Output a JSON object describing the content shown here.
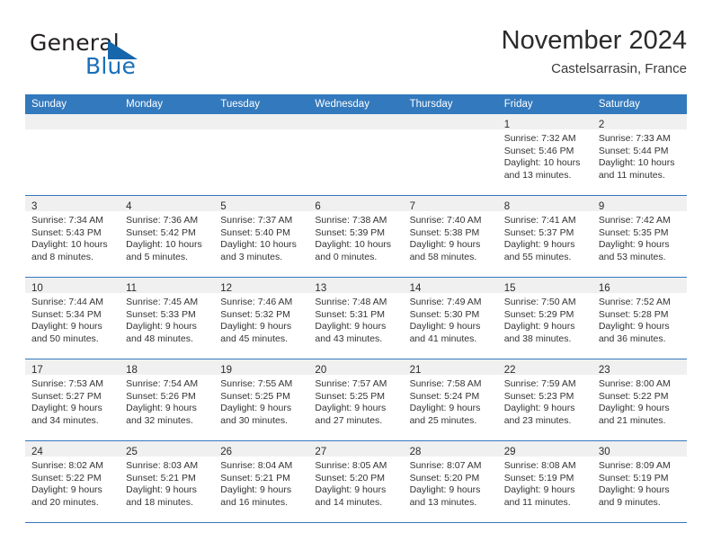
{
  "brand": {
    "word1": "General",
    "word2": "Blue",
    "flag_icon": "triangle-flag-icon",
    "blue": "#1566ab"
  },
  "header": {
    "title": "November 2024",
    "subtitle": "Castelsarrasin, France"
  },
  "calendar": {
    "accent_color": "#3379bd",
    "daynum_band_color": "#f0f0f0",
    "day_headers": [
      "Sunday",
      "Monday",
      "Tuesday",
      "Wednesday",
      "Thursday",
      "Friday",
      "Saturday"
    ],
    "weeks": [
      [
        {
          "day": "",
          "sunrise": "",
          "sunset": "",
          "daylight": ""
        },
        {
          "day": "",
          "sunrise": "",
          "sunset": "",
          "daylight": ""
        },
        {
          "day": "",
          "sunrise": "",
          "sunset": "",
          "daylight": ""
        },
        {
          "day": "",
          "sunrise": "",
          "sunset": "",
          "daylight": ""
        },
        {
          "day": "",
          "sunrise": "",
          "sunset": "",
          "daylight": ""
        },
        {
          "day": "1",
          "sunrise": "Sunrise: 7:32 AM",
          "sunset": "Sunset: 5:46 PM",
          "daylight": "Daylight: 10 hours and 13 minutes."
        },
        {
          "day": "2",
          "sunrise": "Sunrise: 7:33 AM",
          "sunset": "Sunset: 5:44 PM",
          "daylight": "Daylight: 10 hours and 11 minutes."
        }
      ],
      [
        {
          "day": "3",
          "sunrise": "Sunrise: 7:34 AM",
          "sunset": "Sunset: 5:43 PM",
          "daylight": "Daylight: 10 hours and 8 minutes."
        },
        {
          "day": "4",
          "sunrise": "Sunrise: 7:36 AM",
          "sunset": "Sunset: 5:42 PM",
          "daylight": "Daylight: 10 hours and 5 minutes."
        },
        {
          "day": "5",
          "sunrise": "Sunrise: 7:37 AM",
          "sunset": "Sunset: 5:40 PM",
          "daylight": "Daylight: 10 hours and 3 minutes."
        },
        {
          "day": "6",
          "sunrise": "Sunrise: 7:38 AM",
          "sunset": "Sunset: 5:39 PM",
          "daylight": "Daylight: 10 hours and 0 minutes."
        },
        {
          "day": "7",
          "sunrise": "Sunrise: 7:40 AM",
          "sunset": "Sunset: 5:38 PM",
          "daylight": "Daylight: 9 hours and 58 minutes."
        },
        {
          "day": "8",
          "sunrise": "Sunrise: 7:41 AM",
          "sunset": "Sunset: 5:37 PM",
          "daylight": "Daylight: 9 hours and 55 minutes."
        },
        {
          "day": "9",
          "sunrise": "Sunrise: 7:42 AM",
          "sunset": "Sunset: 5:35 PM",
          "daylight": "Daylight: 9 hours and 53 minutes."
        }
      ],
      [
        {
          "day": "10",
          "sunrise": "Sunrise: 7:44 AM",
          "sunset": "Sunset: 5:34 PM",
          "daylight": "Daylight: 9 hours and 50 minutes."
        },
        {
          "day": "11",
          "sunrise": "Sunrise: 7:45 AM",
          "sunset": "Sunset: 5:33 PM",
          "daylight": "Daylight: 9 hours and 48 minutes."
        },
        {
          "day": "12",
          "sunrise": "Sunrise: 7:46 AM",
          "sunset": "Sunset: 5:32 PM",
          "daylight": "Daylight: 9 hours and 45 minutes."
        },
        {
          "day": "13",
          "sunrise": "Sunrise: 7:48 AM",
          "sunset": "Sunset: 5:31 PM",
          "daylight": "Daylight: 9 hours and 43 minutes."
        },
        {
          "day": "14",
          "sunrise": "Sunrise: 7:49 AM",
          "sunset": "Sunset: 5:30 PM",
          "daylight": "Daylight: 9 hours and 41 minutes."
        },
        {
          "day": "15",
          "sunrise": "Sunrise: 7:50 AM",
          "sunset": "Sunset: 5:29 PM",
          "daylight": "Daylight: 9 hours and 38 minutes."
        },
        {
          "day": "16",
          "sunrise": "Sunrise: 7:52 AM",
          "sunset": "Sunset: 5:28 PM",
          "daylight": "Daylight: 9 hours and 36 minutes."
        }
      ],
      [
        {
          "day": "17",
          "sunrise": "Sunrise: 7:53 AM",
          "sunset": "Sunset: 5:27 PM",
          "daylight": "Daylight: 9 hours and 34 minutes."
        },
        {
          "day": "18",
          "sunrise": "Sunrise: 7:54 AM",
          "sunset": "Sunset: 5:26 PM",
          "daylight": "Daylight: 9 hours and 32 minutes."
        },
        {
          "day": "19",
          "sunrise": "Sunrise: 7:55 AM",
          "sunset": "Sunset: 5:25 PM",
          "daylight": "Daylight: 9 hours and 30 minutes."
        },
        {
          "day": "20",
          "sunrise": "Sunrise: 7:57 AM",
          "sunset": "Sunset: 5:25 PM",
          "daylight": "Daylight: 9 hours and 27 minutes."
        },
        {
          "day": "21",
          "sunrise": "Sunrise: 7:58 AM",
          "sunset": "Sunset: 5:24 PM",
          "daylight": "Daylight: 9 hours and 25 minutes."
        },
        {
          "day": "22",
          "sunrise": "Sunrise: 7:59 AM",
          "sunset": "Sunset: 5:23 PM",
          "daylight": "Daylight: 9 hours and 23 minutes."
        },
        {
          "day": "23",
          "sunrise": "Sunrise: 8:00 AM",
          "sunset": "Sunset: 5:22 PM",
          "daylight": "Daylight: 9 hours and 21 minutes."
        }
      ],
      [
        {
          "day": "24",
          "sunrise": "Sunrise: 8:02 AM",
          "sunset": "Sunset: 5:22 PM",
          "daylight": "Daylight: 9 hours and 20 minutes."
        },
        {
          "day": "25",
          "sunrise": "Sunrise: 8:03 AM",
          "sunset": "Sunset: 5:21 PM",
          "daylight": "Daylight: 9 hours and 18 minutes."
        },
        {
          "day": "26",
          "sunrise": "Sunrise: 8:04 AM",
          "sunset": "Sunset: 5:21 PM",
          "daylight": "Daylight: 9 hours and 16 minutes."
        },
        {
          "day": "27",
          "sunrise": "Sunrise: 8:05 AM",
          "sunset": "Sunset: 5:20 PM",
          "daylight": "Daylight: 9 hours and 14 minutes."
        },
        {
          "day": "28",
          "sunrise": "Sunrise: 8:07 AM",
          "sunset": "Sunset: 5:20 PM",
          "daylight": "Daylight: 9 hours and 13 minutes."
        },
        {
          "day": "29",
          "sunrise": "Sunrise: 8:08 AM",
          "sunset": "Sunset: 5:19 PM",
          "daylight": "Daylight: 9 hours and 11 minutes."
        },
        {
          "day": "30",
          "sunrise": "Sunrise: 8:09 AM",
          "sunset": "Sunset: 5:19 PM",
          "daylight": "Daylight: 9 hours and 9 minutes."
        }
      ]
    ]
  }
}
